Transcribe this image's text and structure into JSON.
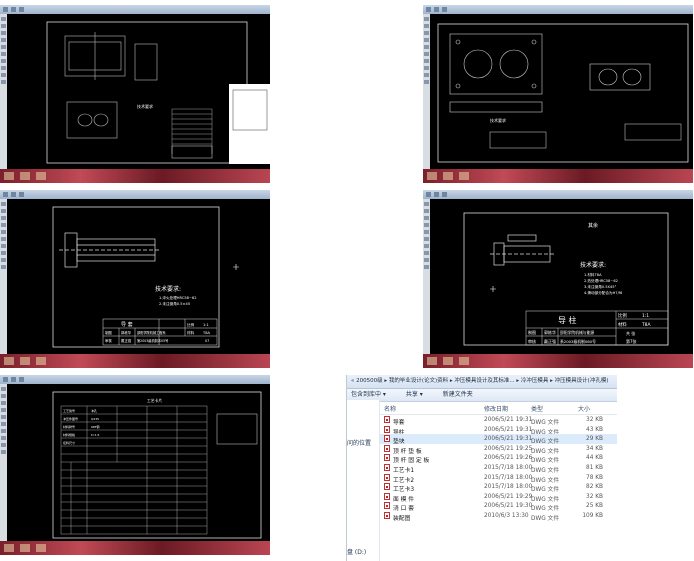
{
  "thumbnails": {
    "t1": {
      "tech_title": "技术要求",
      "title_block": [
        "模具",
        "比例",
        "材料"
      ]
    },
    "t2": {
      "tech_title": "技术要求",
      "title_block": [
        "凸模",
        "比例"
      ]
    },
    "t3": {
      "tech_title": "技术要求:",
      "tech_lines": [
        "1.淬火处理HRC58~62",
        "2.未注倒角0.5×45"
      ],
      "name": "导  套",
      "ratio_label": "比例",
      "ratio_value": "1:1",
      "material_label": "材料",
      "material_value": "T8A",
      "drafter_label": "制图",
      "drafter_name": "郭栋华",
      "checker_label": "审核",
      "checker_name": "戴正强",
      "school": "邵阳学院机械工程系",
      "class": "第2003级机制本05号",
      "sheet": "07"
    },
    "t4": {
      "other_label": "其余",
      "tech_title": "技术要求:",
      "tech_lines": [
        "1.材料T8A",
        "2.热处理HRC58~62",
        "3.未注倒角0.5X45°",
        "4.滑动部分配合为H7/f6"
      ],
      "name": "导  柱",
      "ratio_label": "比例",
      "ratio_value": "1:1",
      "material_label": "材料",
      "material_value": "T8A",
      "drafter_label": "制图",
      "drafter_name": "郭栋华",
      "checker_label": "审核",
      "checker_name": "戴正强",
      "school": "邵阳学院机械与能源",
      "class": "系2003级机制060号",
      "total_label": "共   张",
      "sheet_label": "第7张"
    },
    "t5": {
      "title": "工艺卡片",
      "header_rows": [
        "工艺简号",
        "冲压件图号",
        "材料牌号",
        "材料规格",
        "坯料尺寸"
      ],
      "header_vals": [
        "冲孔",
        "Q235",
        "08F钢",
        "t=1.5"
      ]
    }
  },
  "explorer": {
    "address": "« 200500级 ▸ 我的毕业设计(论文)资料 ▸ 冲压模具设计及其标准... ▸ 冷冲压模具 ▸ 冲压模具设计(冲孔模)",
    "toolbar": [
      "包含到库中 ▾",
      "共享 ▾",
      "新建文件夹"
    ],
    "nav": {
      "location": "问的位置",
      "drive": "盘 (D:)"
    },
    "columns": {
      "name": "名称",
      "date": "修改日期",
      "type": "类型",
      "size": "大小"
    },
    "files": [
      {
        "name": "导套",
        "date": "2006/5/21 19:31",
        "type": "DWG 文件",
        "size": "32 KB"
      },
      {
        "name": "导柱",
        "date": "2006/5/21 19:31",
        "type": "DWG 文件",
        "size": "43 KB"
      },
      {
        "name": "垫块",
        "date": "2006/5/21 19:31",
        "type": "DWG 文件",
        "size": "29 KB"
      },
      {
        "name": "顶 杆 垫 板",
        "date": "2006/5/21 19:25",
        "type": "DWG 文件",
        "size": "34 KB"
      },
      {
        "name": "顶 杆 固 定 板",
        "date": "2006/5/21 19:26",
        "type": "DWG 文件",
        "size": "44 KB"
      },
      {
        "name": "工艺卡1",
        "date": "2015/7/18 18:00",
        "type": "DWG 文件",
        "size": "81 KB"
      },
      {
        "name": "工艺卡2",
        "date": "2015/7/18 18:00",
        "type": "DWG 文件",
        "size": "78 KB"
      },
      {
        "name": "工艺卡3",
        "date": "2015/7/18 18:00",
        "type": "DWG 文件",
        "size": "82 KB"
      },
      {
        "name": "面 模 件",
        "date": "2006/5/21 19:29",
        "type": "DWG 文件",
        "size": "32 KB"
      },
      {
        "name": "浇  口 套",
        "date": "2006/5/21 19:30",
        "type": "DWG 文件",
        "size": "25 KB"
      },
      {
        "name": "装配图",
        "date": "2010/6/3 13:30",
        "type": "DWG 文件",
        "size": "109 KB"
      }
    ]
  }
}
